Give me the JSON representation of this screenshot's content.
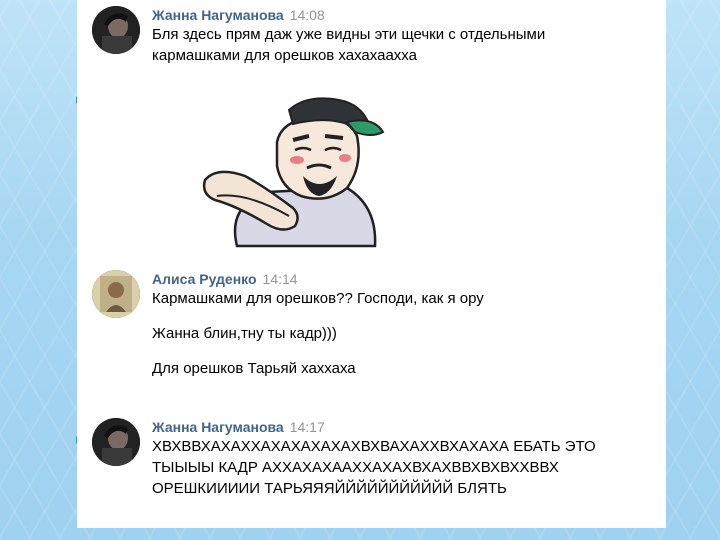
{
  "messages": [
    {
      "author": "Жанна Нагуманова",
      "time": "14:08",
      "lines": [
        "Бля здесь прям даж уже видны эти щечки с отдельными",
        "кармашками для орешков хахахаахха"
      ],
      "sticker": "cartoon-guy-sticker"
    },
    {
      "author": "Алиса Руденко",
      "time": "14:14",
      "lines": [
        "Кармашками для орешков?? Господи, как я ору",
        "Жанна блин,тну ты кадр)))",
        "Для орешков Тарьяй хаххаха"
      ]
    },
    {
      "author": "Жанна Нагуманова",
      "time": "14:17",
      "lines": [
        "ХВХВВХАХАХХАХАХАХАХАХВХВАХАХХВХАХАХА ЕБАТЬ ЭТО",
        "ТЫЫЫЫ КАДР АХХАХАХААХХАХАХВХАХВВХВХВХХВВХ",
        "ОРЕШКИИИИИ ТАРЬЯЯЯЙЙЙЙЙЙЙЙЙЙЙ БЛЯТЬ"
      ]
    }
  ],
  "colors": {
    "author": "#42648b",
    "time": "#939393",
    "background": "#a6d6f2"
  }
}
